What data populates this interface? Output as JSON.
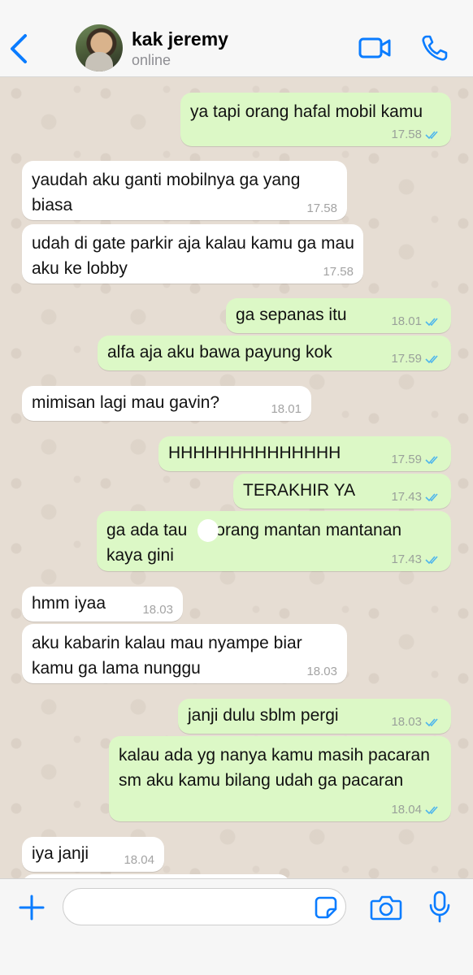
{
  "header": {
    "contact_name": "kak jeremy",
    "status": "online"
  },
  "colors": {
    "accent": "#0a7cff",
    "outgoing_bubble": "#dcf8c6",
    "incoming_bubble": "#ffffff",
    "read_ticks": "#4fb6ec",
    "chat_background": "#e6ddd3"
  },
  "icons": {
    "back": "chevron-left-icon",
    "video": "video-call-icon",
    "phone": "phone-call-icon",
    "attach": "plus-icon",
    "sticker": "sticker-icon",
    "camera": "camera-icon",
    "mic": "microphone-icon"
  },
  "messages": [
    {
      "direction": "out",
      "text": "ya tapi orang hafal mobil kamu",
      "time": "17.58",
      "read": true
    },
    {
      "direction": "in",
      "text": "yaudah aku ganti mobilnya ga yang biasa",
      "time": "17.58"
    },
    {
      "direction": "in",
      "text": "udah di gate parkir aja kalau kamu ga mau aku ke lobby",
      "time": "17.58"
    },
    {
      "direction": "out",
      "text": "ga sepanas itu",
      "time": "18.01",
      "read": true
    },
    {
      "direction": "out",
      "text": "alfa aja aku bawa payung kok",
      "time": "17.59",
      "read": true
    },
    {
      "direction": "in",
      "text": "mimisan lagi mau gavin?",
      "time": "18.01"
    },
    {
      "direction": "out",
      "text": "HHHHHHHHHHHHHH",
      "time": "17.59",
      "read": true
    },
    {
      "direction": "out",
      "text": "TERAKHIR YA",
      "time": "17.43",
      "read": true
    },
    {
      "direction": "out",
      "text": "ga ada tau      orang mantan mantanan kaya gini",
      "time": "17.43",
      "read": true
    },
    {
      "direction": "in",
      "text": "hmm iyaa",
      "time": "18.03"
    },
    {
      "direction": "in",
      "text": "aku kabarin kalau mau nyampe biar kamu ga lama nunggu",
      "time": "18.03"
    },
    {
      "direction": "out",
      "text": "janji dulu sblm pergi",
      "time": "18.03",
      "read": true
    },
    {
      "direction": "out",
      "text": "kalau ada yg nanya kamu masih pacaran sm aku kamu bilang udah ga pacaran",
      "time": "18.04",
      "read": true
    },
    {
      "direction": "in",
      "text": "iya janji",
      "time": "18.04"
    }
  ],
  "composer": {
    "value": "",
    "placeholder": ""
  }
}
